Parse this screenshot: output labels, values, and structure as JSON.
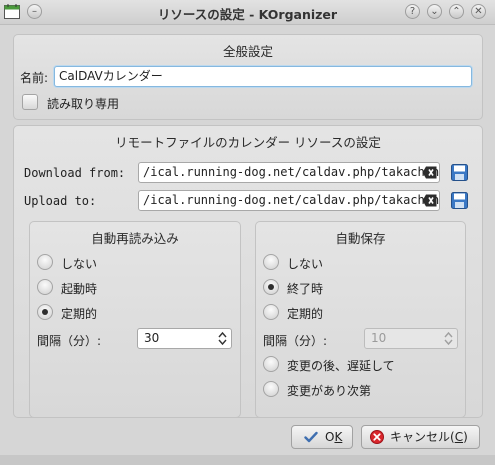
{
  "window": {
    "title": "リソースの設定 - KOrganizer",
    "app_icon": "calendar-icon",
    "controls": [
      "help-icon",
      "minimize-icon",
      "maximize-icon",
      "close-icon"
    ]
  },
  "general": {
    "title": "全般設定",
    "name_label": "名前:",
    "name_value": "CalDAVカレンダー",
    "readonly_label": "読み取り専用"
  },
  "remote": {
    "title": "リモートファイルのカレンダー リソースの設定",
    "download_label": "Download from:",
    "download_value": "/ical.running-dog.net/caldav.php/takachan/home",
    "upload_label": "Upload to:",
    "upload_value": "/ical.running-dog.net/caldav.php/takachan/home"
  },
  "reload": {
    "title": "自動再読み込み",
    "options": [
      "しない",
      "起動時",
      "定期的"
    ],
    "selected": "定期的",
    "interval_label": "間隔（分）:",
    "interval_value": "30"
  },
  "autosave": {
    "title": "自動保存",
    "options": [
      "しない",
      "終了時",
      "定期的"
    ],
    "selected": "終了時",
    "interval_label": "間隔（分）:",
    "interval_value": "10",
    "delay_label": "変更の後、遅延して",
    "every_change_label": "変更があり次第"
  },
  "buttons": {
    "ok_main": "O",
    "ok_mnemonic": "K",
    "cancel_main": "キャンセル(",
    "cancel_mnemonic": "C",
    "cancel_close": ")"
  }
}
